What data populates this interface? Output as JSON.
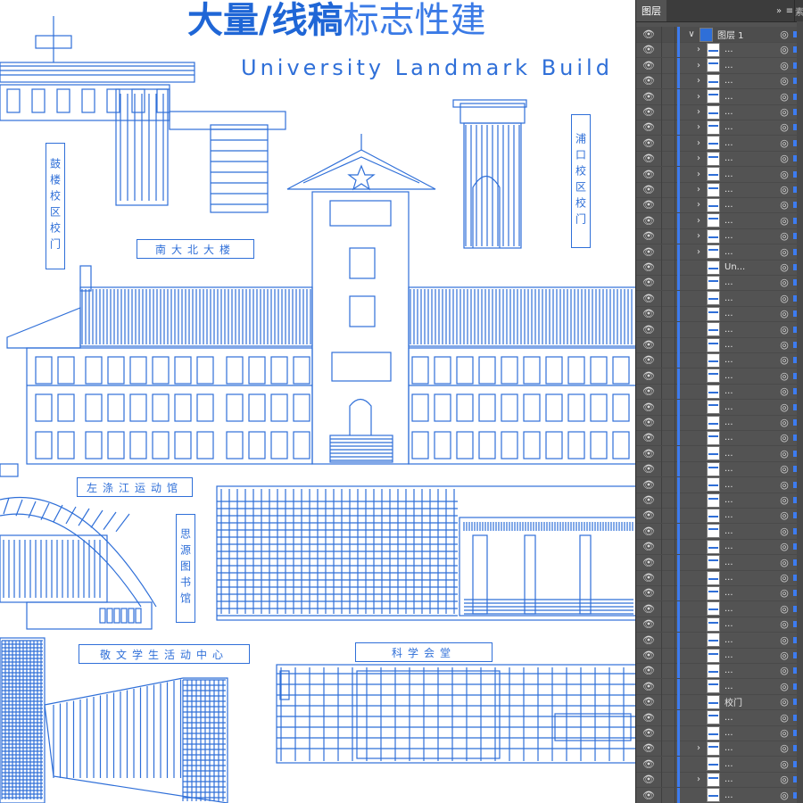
{
  "canvas": {
    "heading_cn_bold": "大量/线稿",
    "heading_cn_thin": "标志性建",
    "heading_en": "University Landmark Build",
    "labels": {
      "gulou_gate": "鼓楼校区校门",
      "pukou_gate": "浦口校区校门",
      "north_building": "南大北大楼",
      "stadium": "左涤江运动馆",
      "library": "思源图书馆",
      "student_center": "敬文学生活动中心",
      "science_hall": "科学会堂"
    }
  },
  "layers_panel": {
    "tab_label": "图层",
    "collapse_icon": "»",
    "menu_icon": "≡",
    "edge_label": "素",
    "top_layer": {
      "name": "图层 1"
    },
    "rows": [
      {
        "name": "...",
        "expandable": true
      },
      {
        "name": "...",
        "expandable": true
      },
      {
        "name": "...",
        "expandable": true
      },
      {
        "name": "...",
        "expandable": true
      },
      {
        "name": "...",
        "expandable": true
      },
      {
        "name": "...",
        "expandable": true
      },
      {
        "name": "...",
        "expandable": true
      },
      {
        "name": "...",
        "expandable": true
      },
      {
        "name": "...",
        "expandable": true
      },
      {
        "name": "...",
        "expandable": true
      },
      {
        "name": "...",
        "expandable": true
      },
      {
        "name": "...",
        "expandable": true
      },
      {
        "name": "...",
        "expandable": true
      },
      {
        "name": "...",
        "expandable": true
      },
      {
        "name": "Un...",
        "expandable": false
      },
      {
        "name": "...",
        "expandable": false
      },
      {
        "name": "...",
        "expandable": false
      },
      {
        "name": "...",
        "expandable": false
      },
      {
        "name": "...",
        "expandable": false
      },
      {
        "name": "...",
        "expandable": false
      },
      {
        "name": "...",
        "expandable": false
      },
      {
        "name": "...",
        "expandable": false
      },
      {
        "name": "...",
        "expandable": false
      },
      {
        "name": "...",
        "expandable": false
      },
      {
        "name": "...",
        "expandable": false
      },
      {
        "name": "...",
        "expandable": false
      },
      {
        "name": "...",
        "expandable": false
      },
      {
        "name": "...",
        "expandable": false
      },
      {
        "name": "...",
        "expandable": false
      },
      {
        "name": "...",
        "expandable": false
      },
      {
        "name": "...",
        "expandable": false
      },
      {
        "name": "...",
        "expandable": false
      },
      {
        "name": "...",
        "expandable": false
      },
      {
        "name": "...",
        "expandable": false
      },
      {
        "name": "...",
        "expandable": false
      },
      {
        "name": "...",
        "expandable": false
      },
      {
        "name": "...",
        "expandable": false
      },
      {
        "name": "...",
        "expandable": false
      },
      {
        "name": "...",
        "expandable": false
      },
      {
        "name": "...",
        "expandable": false
      },
      {
        "name": "...",
        "expandable": false
      },
      {
        "name": "...",
        "expandable": false
      },
      {
        "name": "校门",
        "expandable": false
      },
      {
        "name": "...",
        "expandable": false
      },
      {
        "name": "...",
        "expandable": false
      },
      {
        "name": "...",
        "expandable": true
      },
      {
        "name": "...",
        "expandable": false
      },
      {
        "name": "...",
        "expandable": true
      },
      {
        "name": "...",
        "expandable": false
      },
      {
        "name": "...",
        "expandable": false
      },
      {
        "name": "...",
        "expandable": false
      }
    ]
  },
  "colors": {
    "line_blue": "#2f6fd8",
    "panel_bg": "#535353",
    "layer_color": "#3d7cf0"
  }
}
